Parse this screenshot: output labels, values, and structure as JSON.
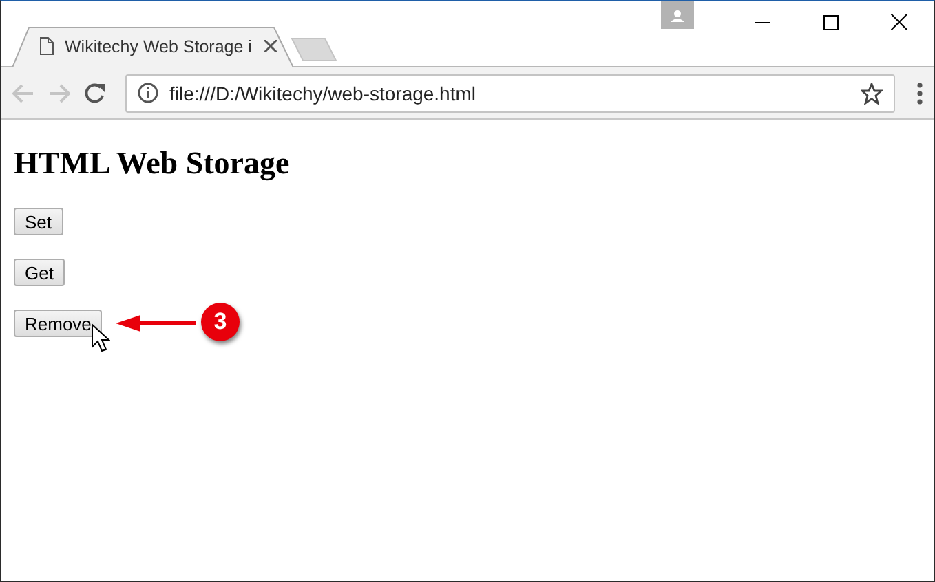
{
  "tab": {
    "title": "Wikitechy Web Storage i"
  },
  "address_bar": {
    "url": "file:///D:/Wikitechy/web-storage.html"
  },
  "page": {
    "heading": "HTML Web Storage",
    "buttons": [
      {
        "label": "Set"
      },
      {
        "label": "Get"
      },
      {
        "label": "Remove"
      }
    ]
  },
  "annotation": {
    "number": "3"
  }
}
